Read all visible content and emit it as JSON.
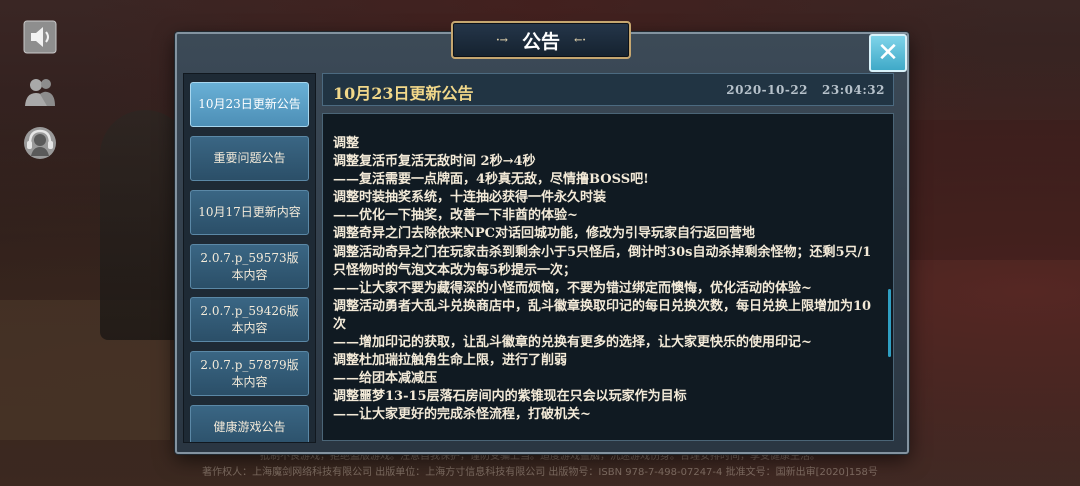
{
  "dialog": {
    "title": "公告",
    "title_deco_left": "·→",
    "title_deco_right": "←·",
    "close_label": "✕"
  },
  "sidebar_icons": [
    {
      "icon": "speaker-icon"
    },
    {
      "icon": "friends-icon"
    },
    {
      "icon": "headset-icon"
    }
  ],
  "nav": {
    "items": [
      {
        "label": "10月23日更新公告",
        "active": true
      },
      {
        "label": "重要问题公告",
        "active": false
      },
      {
        "label": "10月17日更新内容",
        "active": false
      },
      {
        "label": "2.0.7.p_59573版本内容",
        "active": false
      },
      {
        "label": "2.0.7.p_59426版本内容",
        "active": false
      },
      {
        "label": "2.0.7.p_57879版本内容",
        "active": false
      },
      {
        "label": "健康游戏公告",
        "active": false
      }
    ]
  },
  "announcement": {
    "title": "10月23日更新公告",
    "date": "2020-10-22",
    "time": "23:04:32",
    "lines": [
      "调整",
      "调整复活币复活无敌时间  2秒→4秒",
      "——复活需要一点牌面，4秒真无敌，尽情撸BOSS吧!",
      "调整时装抽奖系统，十连抽必获得一件永久时装",
      "——优化一下抽奖，改善一下非酋的体验~",
      "调整奇异之门去除依来NPC对话回城功能，修改为引导玩家自行返回营地",
      "调整活动奇异之门在玩家击杀到剩余小于5只怪后，倒计时30s自动杀掉剩余怪物；还剩5只/1只怪物时的气泡文本改为每5秒提示一次；",
      "——让大家不要为藏得深的小怪而烦恼，不要为错过绑定而懊悔，优化活动的体验~",
      "调整活动勇者大乱斗兑换商店中，乱斗徽章换取印记的每日兑换次数，每日兑换上限增加为10次",
      "——增加印记的获取，让乱斗徽章的兑换有更多的选择，让大家更快乐的使用印记~",
      "调整杜加瑞拉触角生命上限，进行了削弱",
      "——给团本减减压",
      "调整噩梦13-15层落石房间内的紫锥现在只会以玩家作为目标",
      "——让大家更好的完成杀怪流程，打破机关~"
    ]
  },
  "footer": {
    "line1": "抵制不良游戏，拒绝盗版游戏。注意自我保护，谨防受骗上当。适度游戏益脑，沉迷游戏伤身。合理安排时间，享受健康生活。",
    "line2": "著作权人：上海魔剑网络科技有限公司    出版单位：上海方寸信息科技有限公司    出版物号：ISBN 978-7-498-07247-4    批准文号：国新出审[2020]158号"
  },
  "colors": {
    "accent": "#6fc4e3",
    "title_gold": "#f2d88a",
    "panel_border": "#8393a0"
  }
}
